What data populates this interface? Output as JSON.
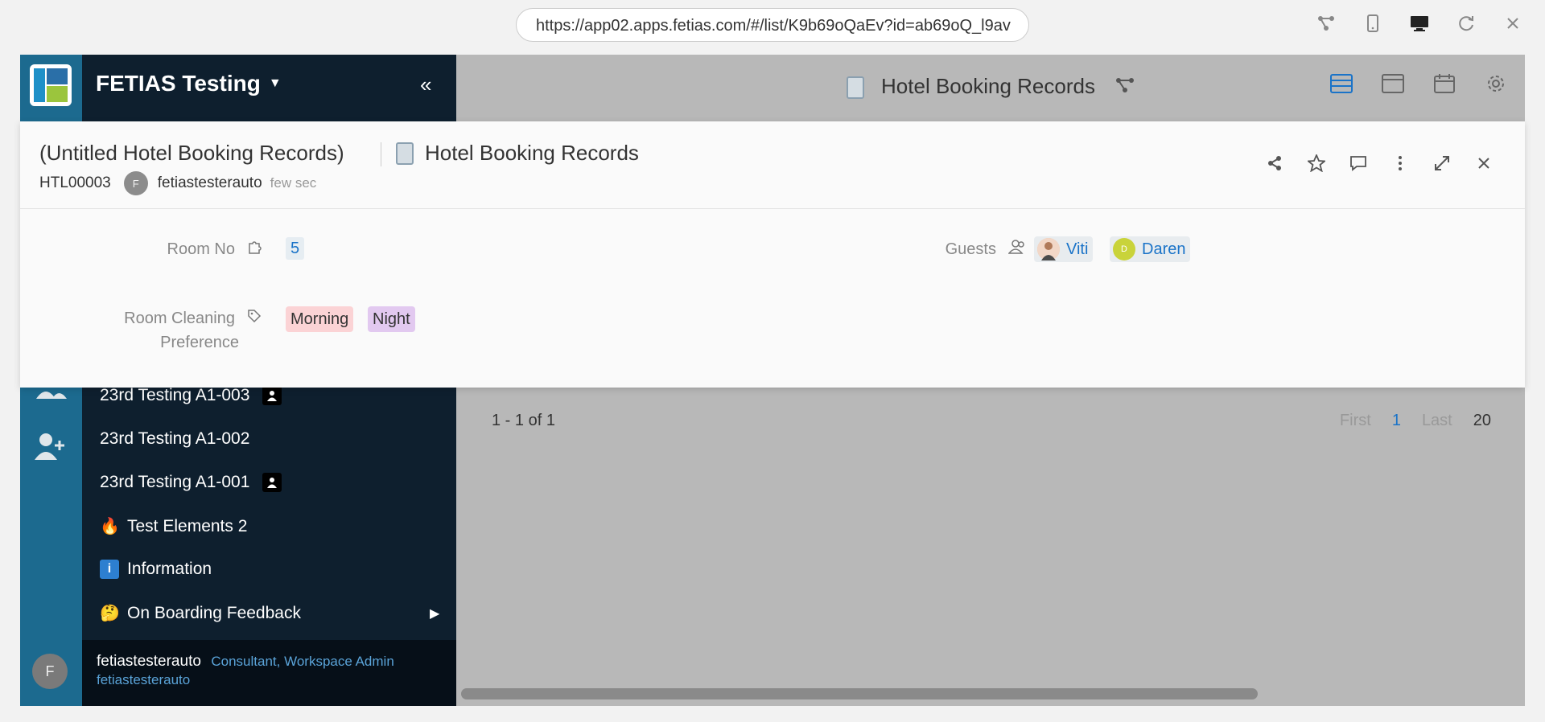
{
  "browser": {
    "url": "https://app02.apps.fetias.com/#/list/K9b69oQaEv?id=ab69oQ_l9av",
    "icons": [
      "share-graph-icon",
      "mobile-icon",
      "desktop-icon",
      "refresh-icon",
      "close-icon"
    ]
  },
  "workspace": {
    "name": "FETIAS Testing",
    "collapse": "«"
  },
  "sidebar": {
    "items": [
      {
        "label": "23rd Testing A1-003",
        "badge": "person"
      },
      {
        "label": "23rd Testing A1-002"
      },
      {
        "label": "23rd Testing A1-001",
        "badge": "person"
      },
      {
        "label": "Test Elements 2",
        "icon": "🔥"
      },
      {
        "label": "Information",
        "icon": "i"
      },
      {
        "label": "On Boarding Feedback",
        "icon": "🤔",
        "expand": "▶"
      }
    ],
    "user": {
      "avatar": "F",
      "name": "fetiastesterauto",
      "role": "Consultant, Workspace Admin",
      "username": "fetiastesterauto"
    }
  },
  "main": {
    "title": "Hotel Booking Records",
    "pager": {
      "summary": "1 - 1 of 1",
      "first": "First",
      "current": "1",
      "last": "Last",
      "page_size": "20"
    }
  },
  "record": {
    "title": "(Untitled Hotel Booking Records)",
    "table_name": "Hotel Booking Records",
    "id": "HTL00003",
    "creator_avatar": "F",
    "creator": "fetiastesterauto",
    "time": "few sec",
    "fields": {
      "room_no_label": "Room No",
      "room_no_value": "5",
      "guests_label": "Guests",
      "guests": [
        {
          "name": "Viti",
          "avatar": ""
        },
        {
          "name": "Daren",
          "avatar": "D"
        }
      ],
      "cleaning_label_1": "Room Cleaning",
      "cleaning_label_2": "Preference",
      "cleaning_values": [
        "Morning",
        "Night"
      ]
    }
  },
  "colors": {
    "accent": "#1a73c8",
    "rail": "#1c6a8f",
    "sidebar": "#0e1f2e",
    "overlay": "#b8b8b8",
    "chip_morning": "#fbd3d5",
    "chip_night": "#e2c9f0"
  }
}
